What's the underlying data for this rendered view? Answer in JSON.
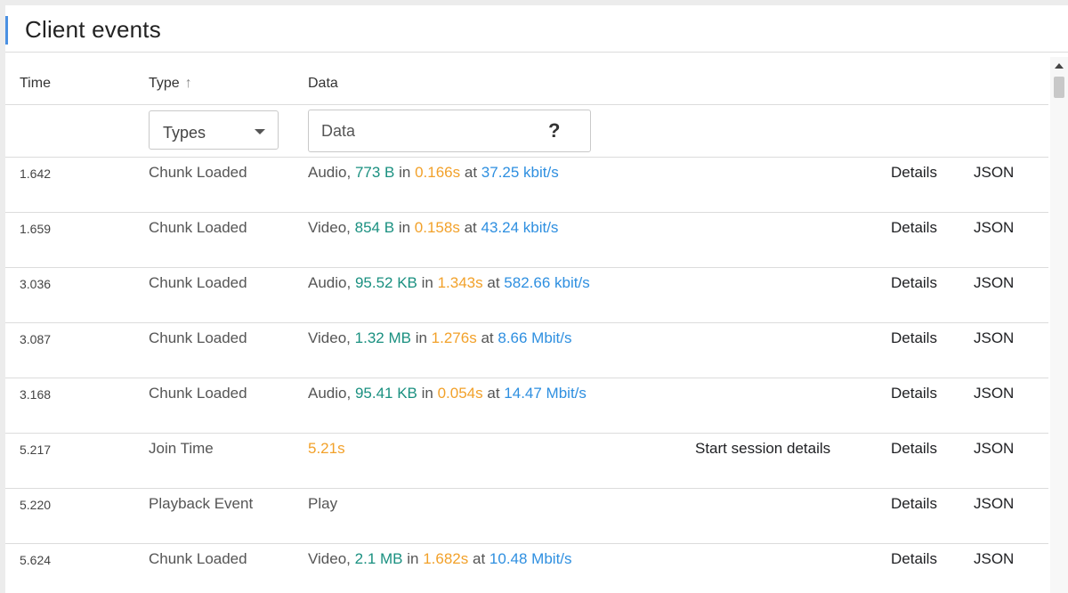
{
  "panel": {
    "title": "Client events"
  },
  "columns": {
    "time": "Time",
    "type": "Type",
    "type_sort_icon": "arrow-up-icon",
    "data": "Data"
  },
  "filters": {
    "types_selected": "Types",
    "data_placeholder": "Data",
    "help_label": "?"
  },
  "actions": {
    "details": "Details",
    "json": "JSON"
  },
  "colors": {
    "size": "#1a9080",
    "duration": "#f2a12a",
    "rate": "#2e8fe0",
    "accent": "#4a90e2"
  },
  "events": [
    {
      "time": "1.642",
      "type": "Chunk Loaded",
      "media": "Audio,",
      "size": "773 B",
      "in": "in",
      "duration": "0.166s",
      "at": "at",
      "rate": "37.25 kbit/s"
    },
    {
      "time": "1.659",
      "type": "Chunk Loaded",
      "media": "Video,",
      "size": "854 B",
      "in": "in",
      "duration": "0.158s",
      "at": "at",
      "rate": "43.24 kbit/s"
    },
    {
      "time": "3.036",
      "type": "Chunk Loaded",
      "media": "Audio,",
      "size": "95.52 KB",
      "in": "in",
      "duration": "1.343s",
      "at": "at",
      "rate": "582.66 kbit/s"
    },
    {
      "time": "3.087",
      "type": "Chunk Loaded",
      "media": "Video,",
      "size": "1.32 MB",
      "in": "in",
      "duration": "1.276s",
      "at": "at",
      "rate": "8.66 Mbit/s"
    },
    {
      "time": "3.168",
      "type": "Chunk Loaded",
      "media": "Audio,",
      "size": "95.41 KB",
      "in": "in",
      "duration": "0.054s",
      "at": "at",
      "rate": "14.47 Mbit/s"
    },
    {
      "time": "5.217",
      "type": "Join Time",
      "duration": "5.21s",
      "extra": "Start session details"
    },
    {
      "time": "5.220",
      "type": "Playback Event",
      "text": "Play"
    },
    {
      "time": "5.624",
      "type": "Chunk Loaded",
      "media": "Video,",
      "size": "2.1 MB",
      "in": "in",
      "duration": "1.682s",
      "at": "at",
      "rate": "10.48 Mbit/s"
    }
  ]
}
